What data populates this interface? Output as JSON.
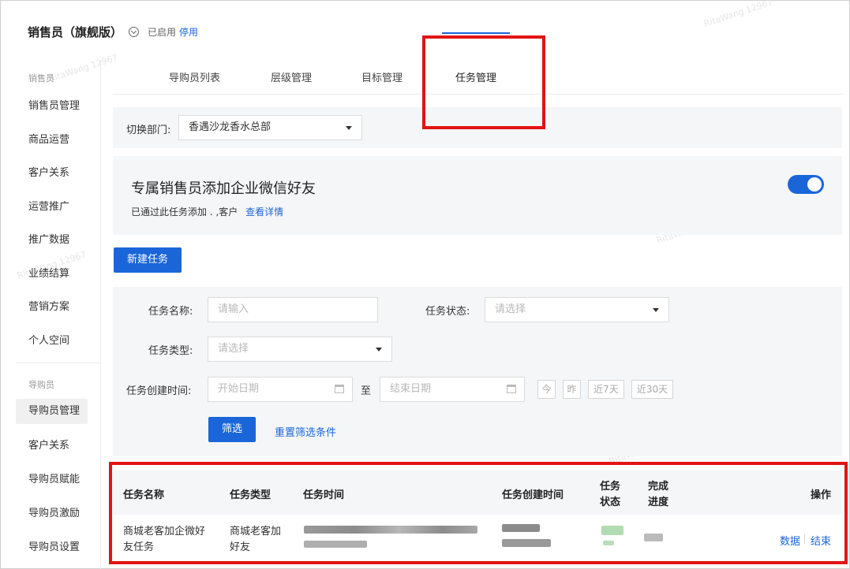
{
  "header": {
    "title": "销售员（旗舰版）",
    "status": "已启用",
    "stop_label": "停用"
  },
  "sidebar": {
    "section1": "销售员",
    "items1": [
      "销售员管理",
      "商品运营",
      "客户关系",
      "运营推广",
      "推广数据",
      "业绩结算",
      "营销方案",
      "个人空间"
    ],
    "section2": "导购员",
    "items2": [
      "导购员管理",
      "客户关系",
      "导购员赋能",
      "导购员激励",
      "导购员设置"
    ]
  },
  "tabs": [
    "导购员列表",
    "层级管理",
    "目标管理",
    "任务管理"
  ],
  "dept": {
    "label": "切换部门:",
    "value": "香遇沙龙香水总部"
  },
  "banner": {
    "title": "专属销售员添加企业微信好友",
    "desc": "已通过此任务添加 . ,客户",
    "link": "查看详情",
    "toggle_on": true
  },
  "new_task_label": "新建任务",
  "filter": {
    "name_label": "任务名称:",
    "name_placeholder": "请输入",
    "status_label": "任务状态:",
    "status_placeholder": "请选择",
    "type_label": "任务类型:",
    "type_placeholder": "请选择",
    "time_label": "任务创建时间:",
    "start_placeholder": "开始日期",
    "to": "至",
    "end_placeholder": "结束日期",
    "quick": [
      "今",
      "昨",
      "近7天",
      "近30天"
    ],
    "submit": "筛选",
    "reset": "重置筛选条件"
  },
  "table": {
    "headers": {
      "name": "任务名称",
      "type": "任务类型",
      "time": "任务时间",
      "created": "任务创建时间",
      "status_l1": "任务",
      "status_l2": "状态",
      "progress_l1": "完成",
      "progress_l2": "进度",
      "ops": "操作"
    },
    "rows": [
      {
        "name": "商城老客加企微好友任务",
        "type": "商城老客加好友",
        "ops": [
          "数据",
          "结束"
        ]
      }
    ]
  },
  "watermark": "RitaWang 12967",
  "colors": {
    "accent": "#1a66d9",
    "highlight": "#e21414",
    "panel": "#f5f6f8"
  }
}
